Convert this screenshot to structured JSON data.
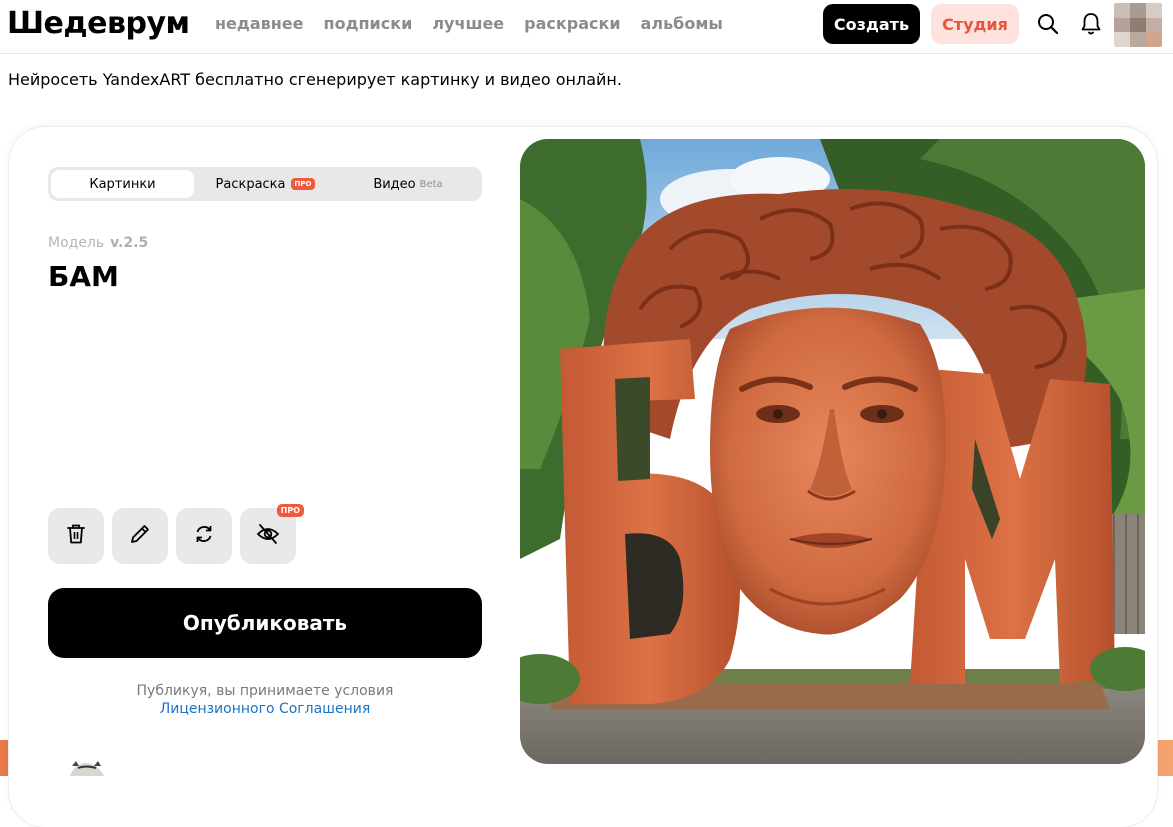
{
  "header": {
    "logo": "Шедеврум",
    "nav": [
      "недавнее",
      "подписки",
      "лучшее",
      "раскраски",
      "альбомы"
    ],
    "create_label": "Создать",
    "studio_label": "Студия"
  },
  "tagline": "Нейросеть YandexART бесплатно сгенерирует картинку и видео онлайн.",
  "generator": {
    "tabs": {
      "images": "Картинки",
      "coloring": "Раскраска",
      "coloring_badge": "ПРО",
      "video": "Видео",
      "video_badge": "Beta"
    },
    "model_label": "Модель",
    "model_version": "v.2.5",
    "prompt": "БАМ",
    "hide_badge": "ПРО",
    "publish_label": "Опубликовать",
    "terms_text": "Публикуя, вы принимаете условия",
    "terms_link": "Лицензионного Соглашения"
  },
  "image": {
    "sculpture_letters": "БАМ"
  },
  "colors": {
    "accent_orange": "#f05a3c",
    "studio_bg": "#fde2dd",
    "link_blue": "#1a73c8"
  }
}
